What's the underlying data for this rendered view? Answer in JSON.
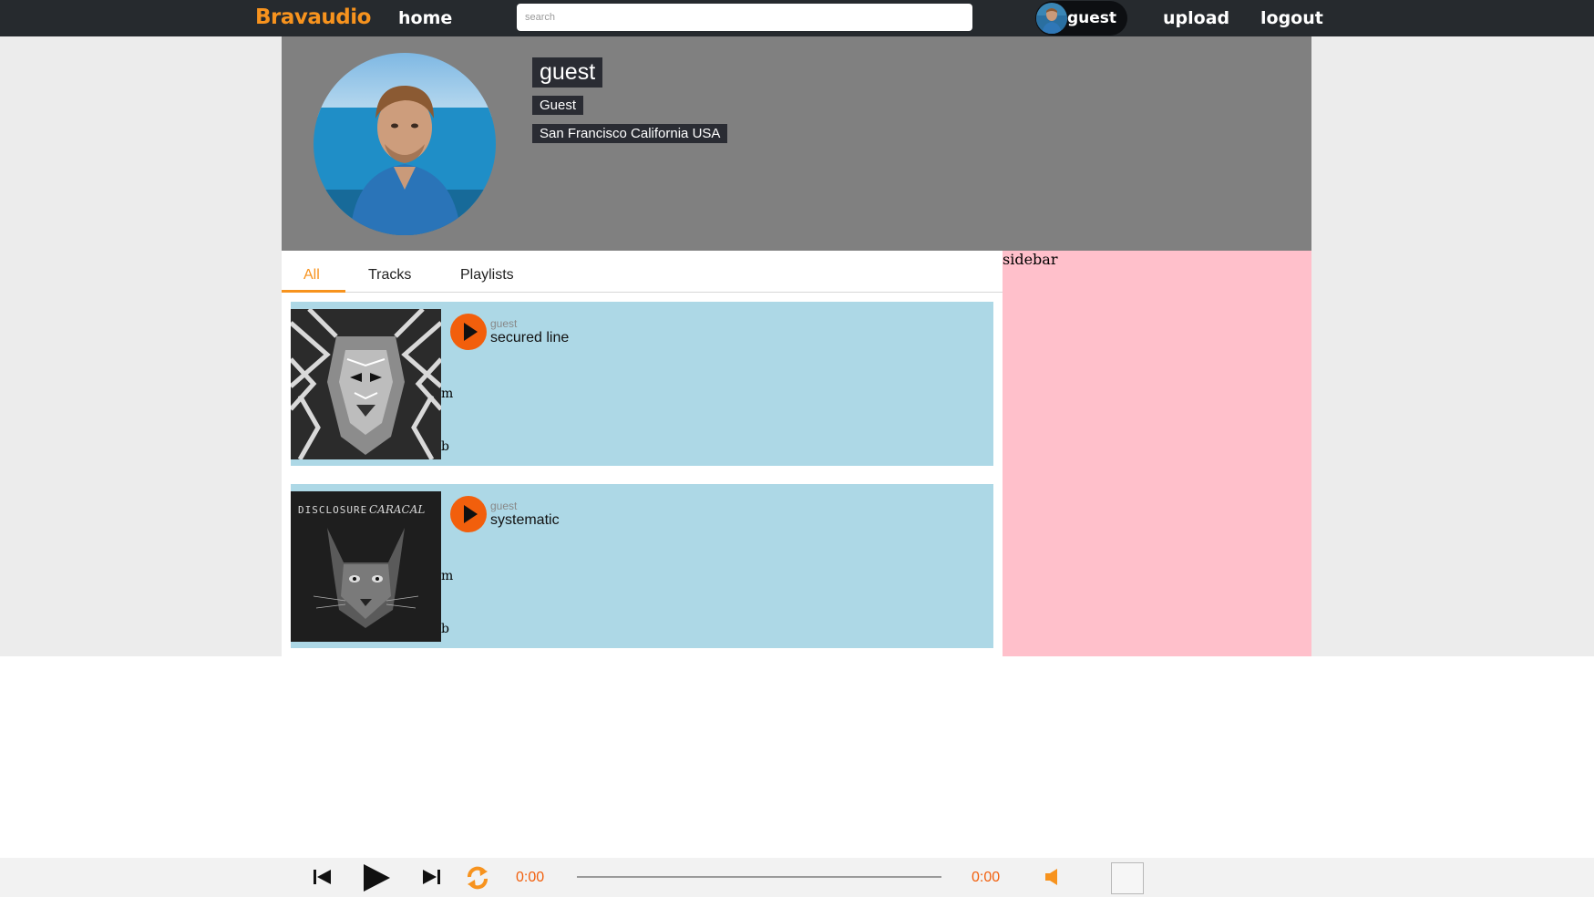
{
  "nav": {
    "logo": "Bravaudio",
    "home": "home",
    "search_placeholder": "search",
    "user": "guest",
    "upload": "upload",
    "logout": "logout"
  },
  "profile": {
    "name": "guest",
    "role": "Guest",
    "location": "San Francisco California USA"
  },
  "tabs": [
    "All",
    "Tracks",
    "Playlists"
  ],
  "active_tab": "All",
  "tracks": [
    {
      "user": "guest",
      "title": "secured line",
      "m": "m",
      "b": "b"
    },
    {
      "user": "guest",
      "title": "systematic",
      "m": "m",
      "b": "b"
    }
  ],
  "sidebar": {
    "label": "sidebar"
  },
  "player": {
    "current_time": "0:00",
    "duration": "0:00",
    "progress": 0
  },
  "colors": {
    "accent": "#f7931e",
    "play": "#f25f0c",
    "nav_bg": "#262a2e",
    "header_bg": "#808080",
    "track_bg": "#add8e6",
    "sidebar_bg": "#ffc0cb"
  }
}
